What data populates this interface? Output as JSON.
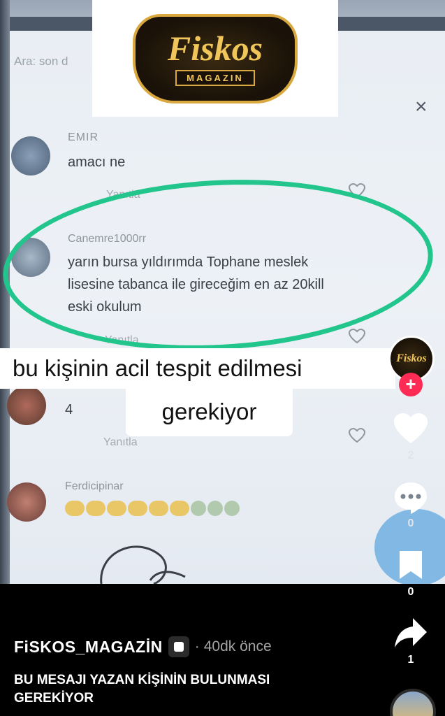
{
  "logo": {
    "title": "Fiskos",
    "subtitle": "MAGAZIN"
  },
  "video_screen": {
    "search_hint": "Ara: son d",
    "close": "×",
    "comments": [
      {
        "username": "EMIR",
        "text": "amacı ne",
        "reply": "Yanıtla"
      },
      {
        "username": "Canemre1000rr",
        "text_line1": "yarın bursa yıldırımda Tophane meslek",
        "text_line2": "lisesine tabanca ile gireceğim en az 20kill",
        "text_line3": "eski okulum",
        "reply": "Yanıtla"
      },
      {
        "username": "",
        "text": "4",
        "reply": "Yanıtla"
      },
      {
        "username": "Ferdicipinar",
        "text": ""
      }
    ]
  },
  "caption": {
    "line1": "bu kişinin acil tespit edilmesi",
    "line2": "gerekiyor"
  },
  "rail": {
    "avatar_text": "Fiskos",
    "follow": "+",
    "likes": "2",
    "comments": "0",
    "saves": "0",
    "shares": "1"
  },
  "post": {
    "author": "FiSKOS_MAGAZİN",
    "separator": "·",
    "time": "40dk önce",
    "description_line1": "BU MESAJI YAZAN KİŞİNİN BULUNMASI",
    "description_line2": "GEREKİYOR"
  },
  "colors": {
    "highlight_ring": "#22c58b",
    "follow_red": "#fe2c55",
    "logo_gold": "#f0c65a"
  }
}
